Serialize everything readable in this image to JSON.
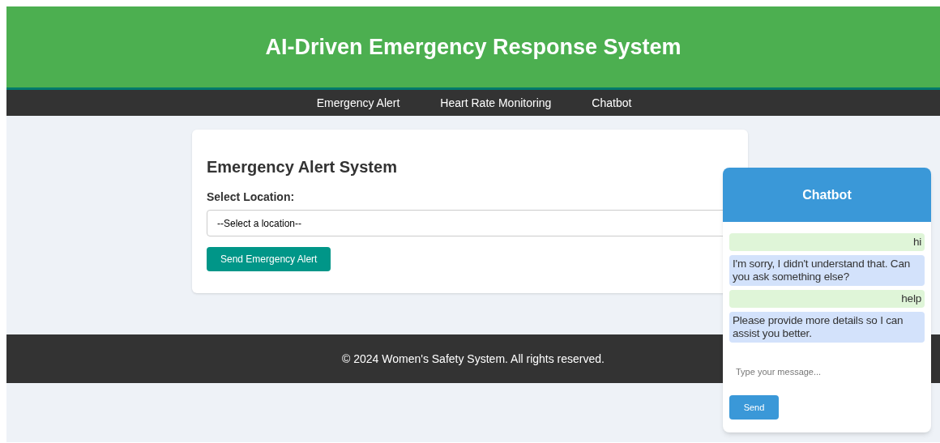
{
  "header": {
    "title": "AI-Driven Emergency Response System"
  },
  "nav": [
    "Emergency Alert",
    "Heart Rate Monitoring",
    "Chatbot"
  ],
  "alert_card": {
    "title": "Emergency Alert System",
    "label": "Select Location:",
    "select_value": "--Select a location--",
    "button": "Send Emergency Alert"
  },
  "footer": "© 2024 Women's Safety System. All rights reserved.",
  "chatbot": {
    "title": "Chatbot",
    "messages": [
      {
        "kind": "user",
        "text": "hi"
      },
      {
        "kind": "bot",
        "text": "I'm sorry, I didn't understand that. Can you ask something else?"
      },
      {
        "kind": "user",
        "text": "help"
      },
      {
        "kind": "bot",
        "text": "Please provide more details so I can assist you better."
      }
    ],
    "placeholder": "Type your message...",
    "send": "Send"
  }
}
